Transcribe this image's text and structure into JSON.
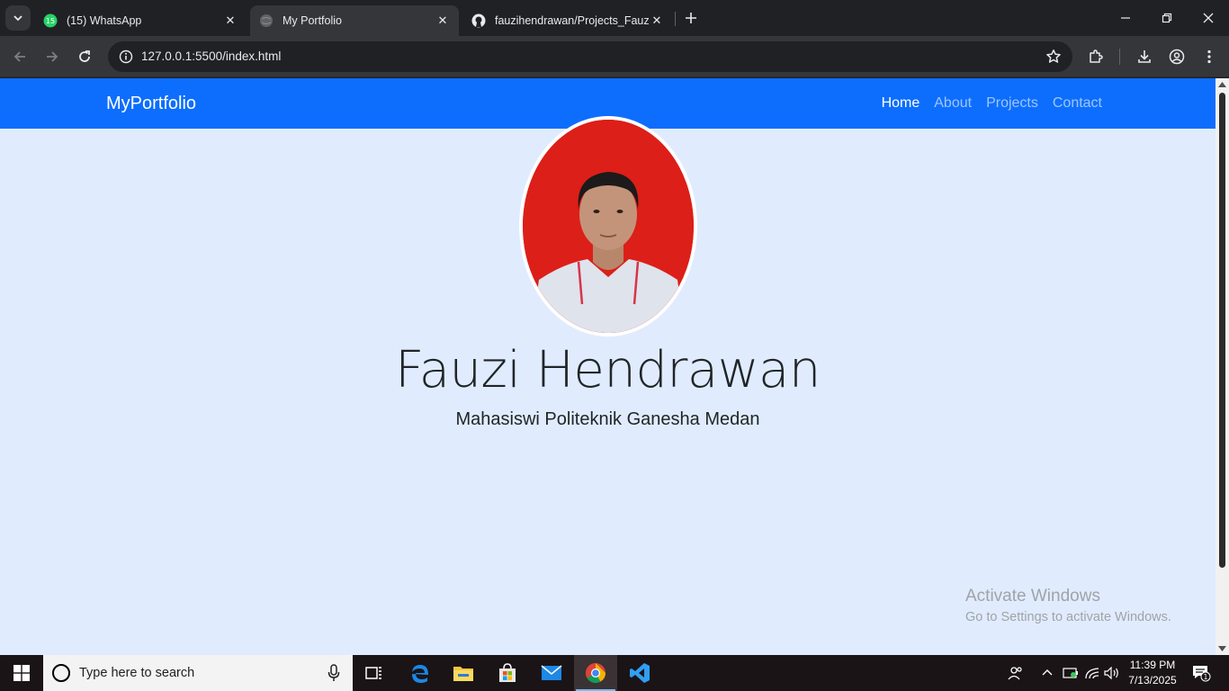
{
  "browser": {
    "tabs": [
      {
        "title": "(15) WhatsApp",
        "badge": "15",
        "active": false
      },
      {
        "title": "My Portfolio",
        "active": true
      },
      {
        "title": "fauzihendrawan/Projects_Fauzi",
        "active": false
      }
    ],
    "url": "127.0.0.1:5500/index.html"
  },
  "page": {
    "brand": "MyPortfolio",
    "nav": [
      {
        "label": "Home",
        "active": true
      },
      {
        "label": "About",
        "active": false
      },
      {
        "label": "Projects",
        "active": false
      },
      {
        "label": "Contact",
        "active": false
      }
    ],
    "hero": {
      "name": "Fauzi Hendrawan",
      "subtitle": "Mahasiswi Politeknik Ganesha Medan"
    },
    "colors": {
      "navbar": "#0d6efd",
      "background": "#e0ecfd",
      "photo_bg": "#dc1f18"
    }
  },
  "os": {
    "watermark": {
      "line1": "Activate Windows",
      "line2": "Go to Settings to activate Windows."
    },
    "search_placeholder": "Type here to search",
    "time": "11:39 PM",
    "date": "7/13/2025",
    "notification_count": "1",
    "taskbar_apps": [
      "task-view-icon",
      "edge-icon",
      "file-explorer-icon",
      "store-icon",
      "mail-icon",
      "chrome-icon",
      "vscode-icon"
    ]
  }
}
